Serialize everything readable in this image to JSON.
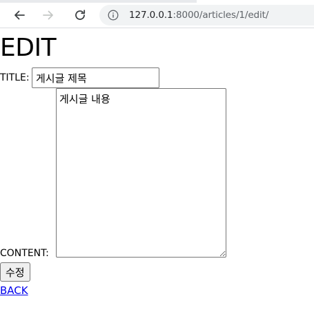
{
  "browser": {
    "url_host": "127.0.0.1",
    "url_rest": ":8000/articles/1/edit/",
    "icons": {
      "back": "back-arrow-icon",
      "forward": "forward-arrow-icon",
      "reload": "reload-icon",
      "info": "info-icon"
    }
  },
  "page": {
    "title": "EDIT",
    "form": {
      "title_label": "TITLE:",
      "title_value": "게시글 제목",
      "content_label": "CONTENT:",
      "content_value": "게시글 내용",
      "submit_label": "수정"
    },
    "back_link": "BACK"
  },
  "colors": {
    "link": "#0000ee",
    "omnibox_bg": "#f1f3f4",
    "button_bg": "#efefef"
  }
}
